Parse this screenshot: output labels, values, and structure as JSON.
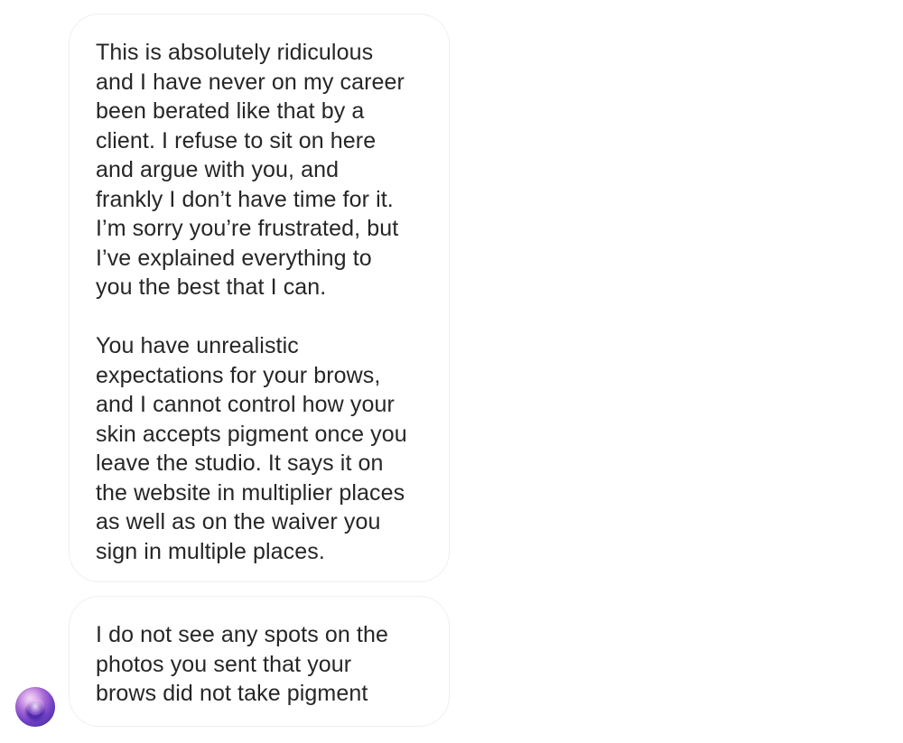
{
  "thread": {
    "messages": [
      {
        "paragraphs": [
          "This is absolutely ridiculous\nand I have never on my career\nbeen berated like that by a\nclient. I refuse to sit on here\nand argue with you, and\nfrankly I don’t have time for it.\nI’m sorry you’re frustrated, but\nI’ve explained everything to\nyou the best that I can.",
          "You have unrealistic\nexpectations for your brows,\nand I cannot control how your\nskin accepts pigment once you\nleave the studio. It says it on\nthe website in multiplier places\nas well as on the waiver you\nsign in multiple places."
        ]
      },
      {
        "paragraphs": [
          "I do not see any spots on the\nphotos you sent that your\nbrows did not take pigment"
        ]
      }
    ],
    "avatar": {
      "icon": "purple-orb-avatar"
    }
  },
  "colors": {
    "text": "#262626",
    "bubble_border": "#efefef",
    "background": "#ffffff"
  }
}
